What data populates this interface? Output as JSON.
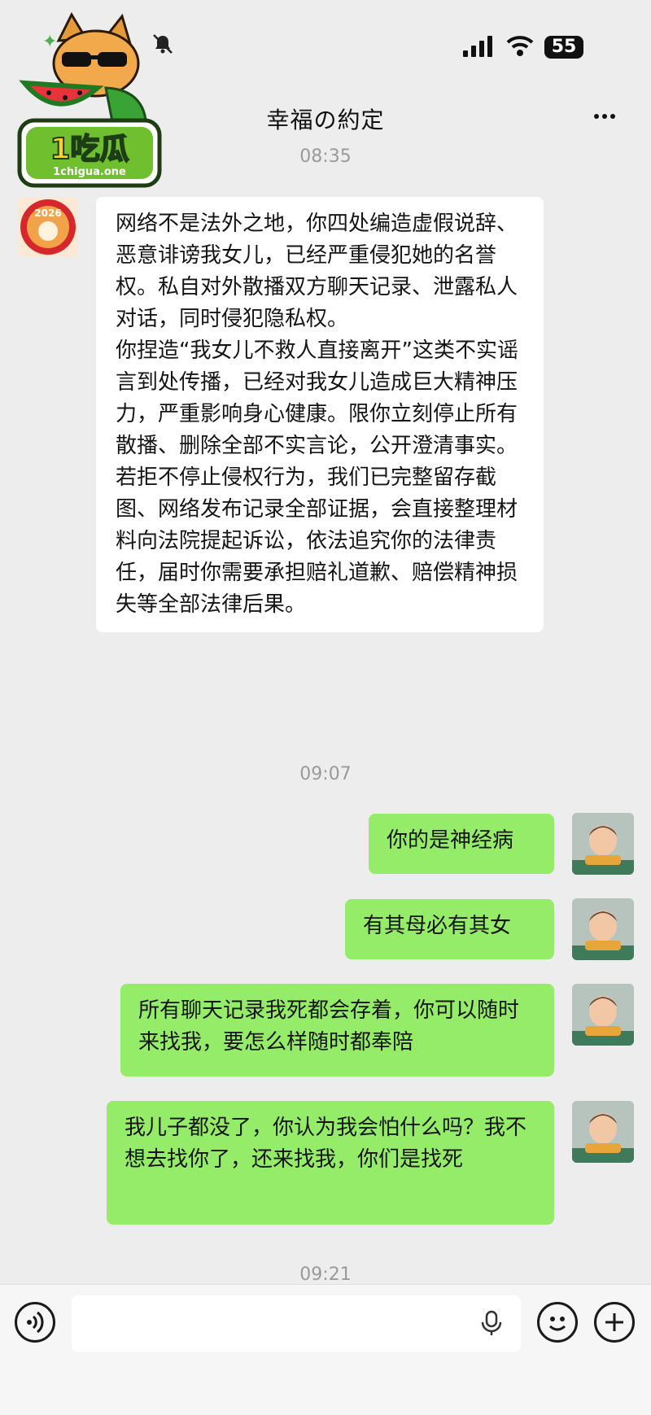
{
  "status_bar": {
    "battery": "55",
    "icons": [
      "mute-bell-icon",
      "cellular-signal-icon",
      "wifi-icon",
      "battery-icon"
    ]
  },
  "header": {
    "title": "幸福の約定",
    "more_icon": "more-dots-icon"
  },
  "watermark": {
    "brand": "1吃瓜",
    "site": "1chigua.one"
  },
  "chat": {
    "timestamps": [
      "08:35",
      "09:07",
      "09:21"
    ],
    "incoming": {
      "avatar_text": "2026",
      "paragraphs": [
        "网络不是法外之地，你四处编造虚假说辞、恶意诽谤我女儿，已经严重侵犯她的名誉权。私自对外散播双方聊天记录、泄露私人对话，同时侵犯隐私权。",
        "你捏造“我女儿不救人直接离开”这类不实谣言到处传播，已经对我女儿造成巨大精神压力，严重影响身心健康。限你立刻停止所有散播、删除全部不实言论，公开澄清事实。",
        "若拒不停止侵权行为，我们已完整留存截图、网络发布记录全部证据，会直接整理材料向法院提起诉讼，依法追究你的法律责任，届时你需要承担赔礼道歉、赔偿精神损失等全部法律后果。"
      ]
    },
    "outgoing": [
      {
        "text": "你的是神经病"
      },
      {
        "text": "有其母必有其女"
      },
      {
        "text": "所有聊天记录我死都会存着，你可以随时来找我，要怎么样随时都奉陪"
      },
      {
        "text": "我儿子都没了，你认为我会怕什么吗？我不想去找你了，还来找我，你们是找死"
      }
    ]
  },
  "input_bar": {
    "icons": [
      "voice-icon",
      "microphone-icon",
      "emoji-icon",
      "plus-icon"
    ]
  }
}
